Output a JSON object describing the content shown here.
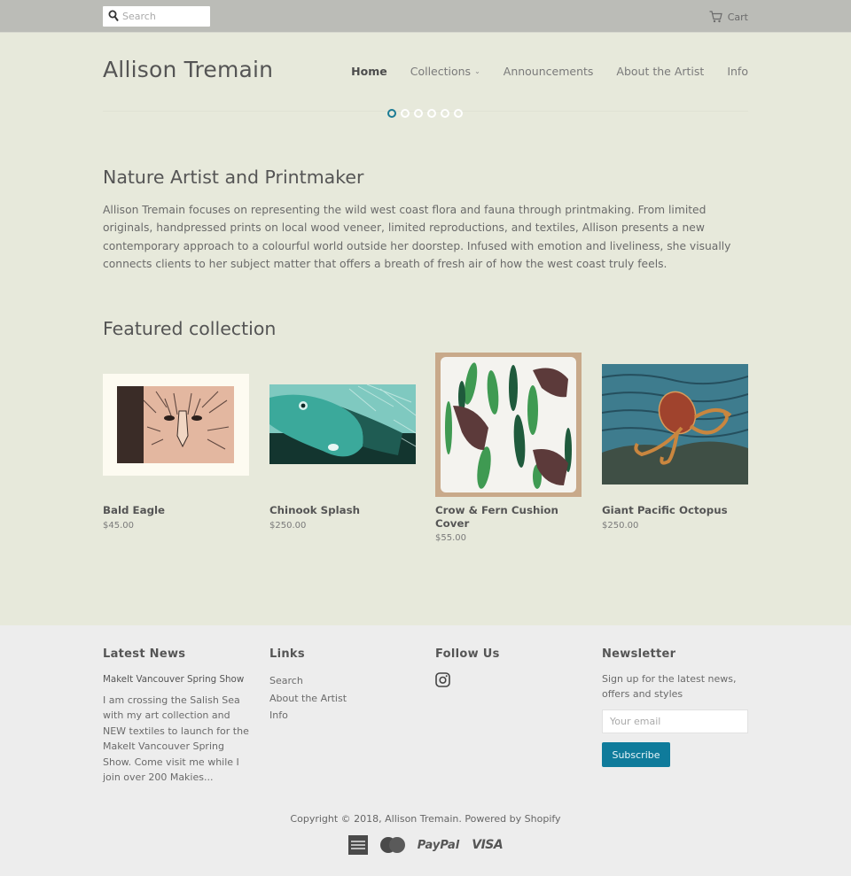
{
  "topbar": {
    "search_placeholder": "Search",
    "cart_label": "Cart"
  },
  "header": {
    "site_title": "Allison Tremain",
    "nav": [
      {
        "label": "Home",
        "active": true
      },
      {
        "label": "Collections",
        "has_dropdown": true
      },
      {
        "label": "Announcements"
      },
      {
        "label": "About the Artist"
      },
      {
        "label": "Info"
      }
    ],
    "chevron": "⌄",
    "slideshow": {
      "slide_count": 6,
      "active_index": 0
    }
  },
  "intro": {
    "title": "Nature Artist and Printmaker",
    "text": " Allison Tremain focuses on representing the wild west coast flora and fauna through printmaking. From limited originals, handpressed prints on local wood veneer, limited reproductions, and textiles, Allison presents a new contemporary approach to a colourful world outside her doorstep. Infused with emotion and liveliness, she visually connects clients to her subject matter that offers a breath of fresh air of how the west coast truly feels."
  },
  "featured": {
    "title": "Featured collection",
    "products": [
      {
        "name": "Bald Eagle",
        "price": "$45.00",
        "image": "bald-eagle-print"
      },
      {
        "name": "Chinook Splash",
        "price": "$250.00",
        "image": "chinook-salmon-print"
      },
      {
        "name": "Crow & Fern Cushion Cover",
        "price": "$55.00",
        "image": "crow-fern-cushion"
      },
      {
        "name": "Giant Pacific Octopus",
        "price": "$250.00",
        "image": "octopus-print"
      }
    ]
  },
  "footer": {
    "latest_news": {
      "heading": "Latest News",
      "article_title": "MakeIt Vancouver Spring Show",
      "article_excerpt": "I am crossing the Salish Sea with my art collection and NEW textiles to launch for the MakeIt Vancouver Spring Show. Come visit me while I join over 200 Makies..."
    },
    "links": {
      "heading": "Links",
      "items": [
        "Search",
        "About the Artist",
        "Info"
      ]
    },
    "follow": {
      "heading": "Follow Us",
      "icons": [
        "instagram-icon"
      ]
    },
    "newsletter": {
      "heading": "Newsletter",
      "text": "Sign up for the latest news, offers and styles",
      "email_placeholder": "Your email",
      "button_label": "Subscribe"
    },
    "copyright": "Copyright © 2018, Allison Tremain. Powered by Shopify",
    "payments": {
      "paypal": "PayPal",
      "visa": "VISA"
    }
  },
  "colors": {
    "background": "#e7e9db",
    "topbar": "#bbbcb7",
    "footer": "#ededed",
    "accent": "#0f7b9b"
  }
}
